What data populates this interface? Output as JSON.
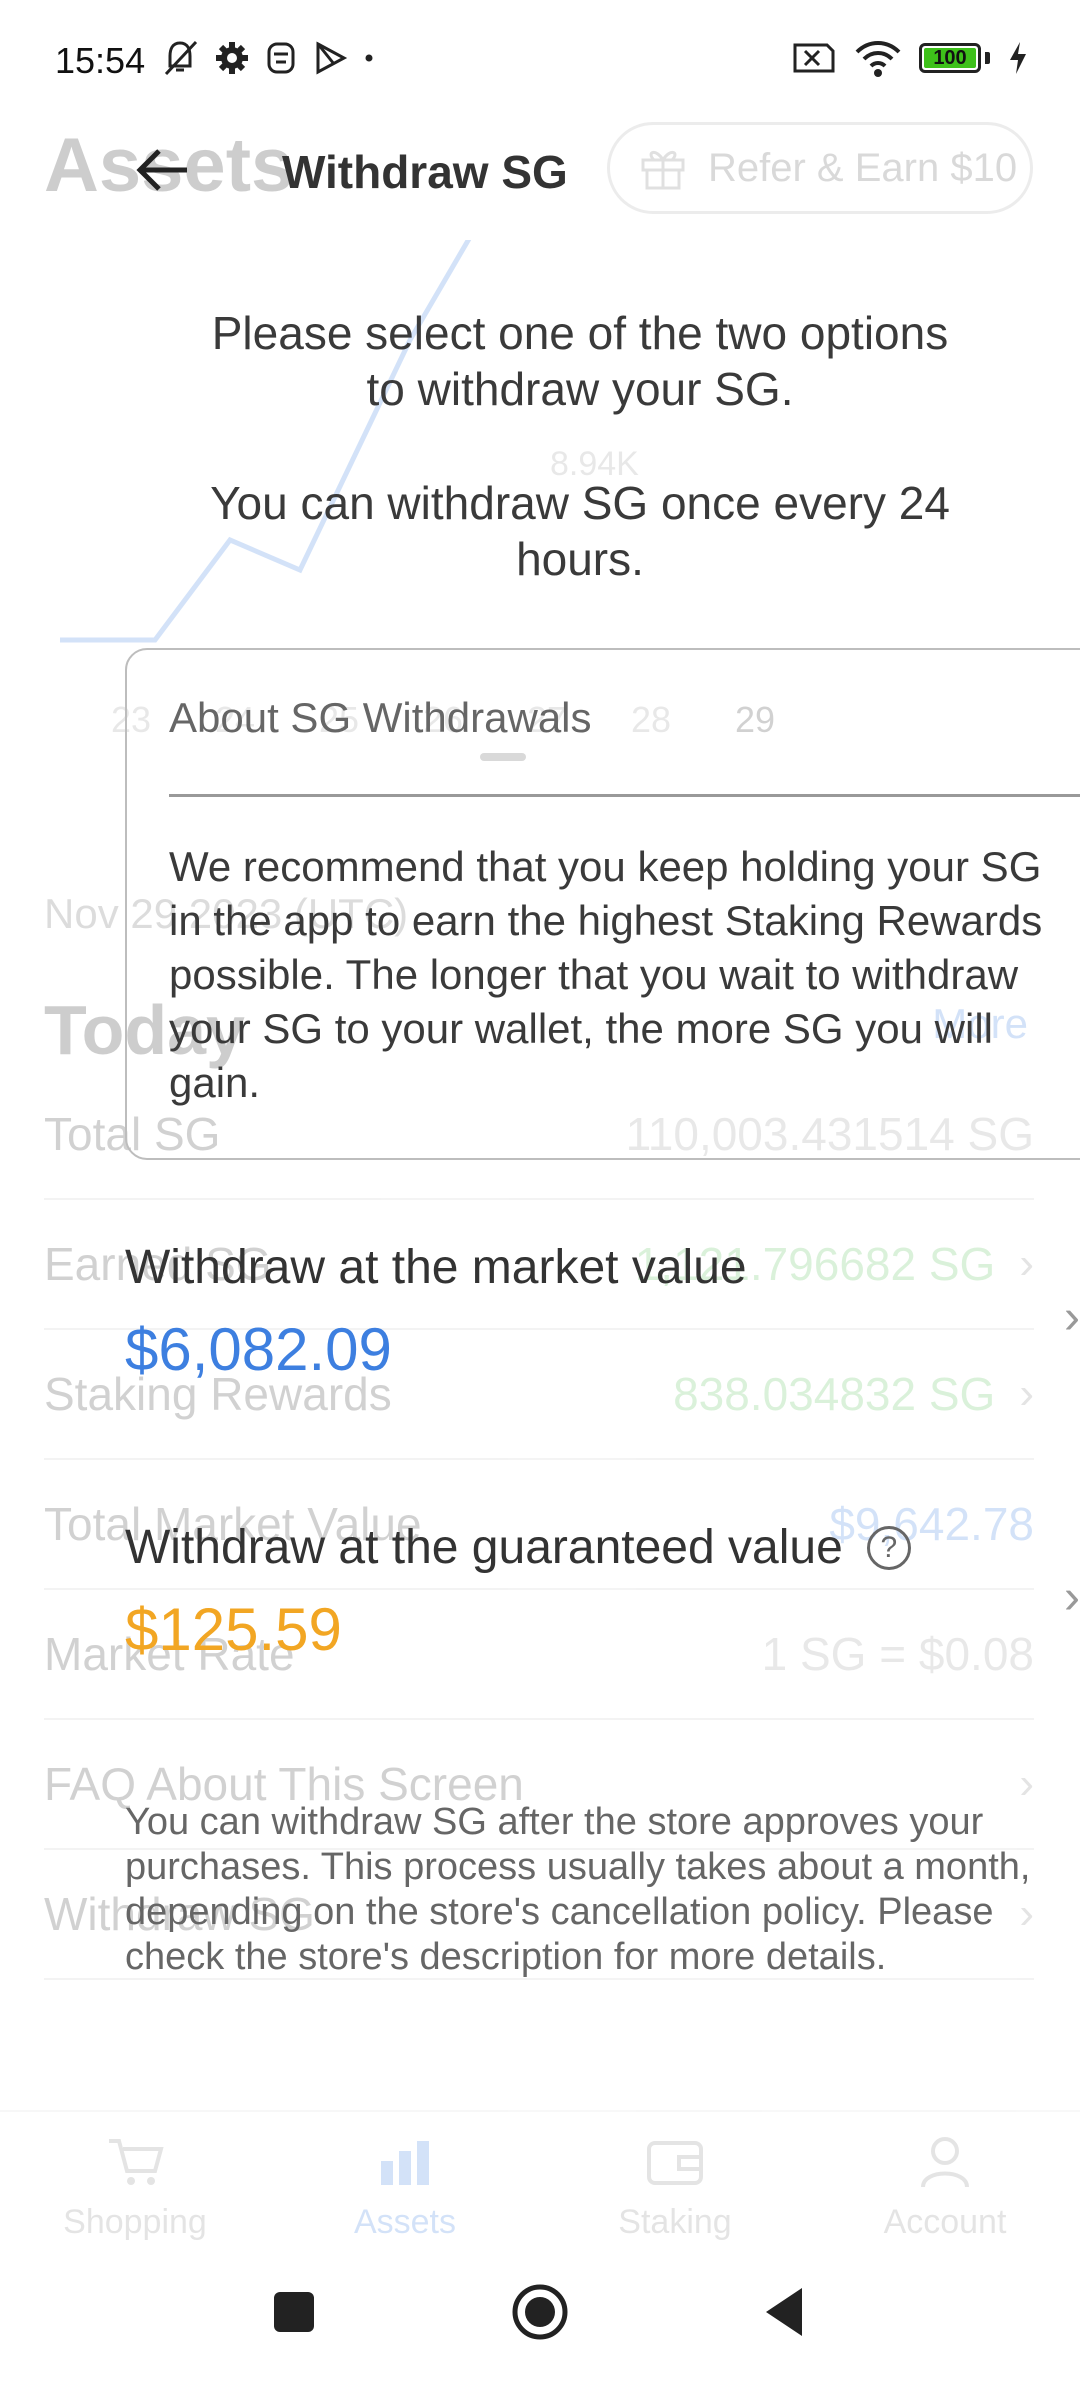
{
  "status_bar": {
    "time": "15:54",
    "battery": "100"
  },
  "background": {
    "title": "Assets",
    "refer_label": "Refer & Earn $10",
    "chart": {
      "days": [
        "23",
        "24",
        "25",
        "26",
        "27",
        "28",
        "29"
      ],
      "selected_day": "29",
      "y_label": "8.94K"
    },
    "date_label": "Nov 29 2023 (UTC)",
    "today_label": "Today",
    "more_label": "More",
    "rows": [
      {
        "label": "Total SG",
        "value": "110,003.431514 SG",
        "tone": "muted",
        "chevron": false
      },
      {
        "label": "Earned SG",
        "value": "1,121.796682 SG",
        "tone": "green",
        "chevron": true
      },
      {
        "label": "Staking Rewards",
        "value": "838.034832 SG",
        "tone": "green",
        "chevron": true
      },
      {
        "label": "Total Market Value",
        "value": "$9,642.78",
        "tone": "blue",
        "chevron": false
      },
      {
        "label": "Market Rate",
        "value": "1 SG = $0.08",
        "tone": "muted",
        "chevron": false
      },
      {
        "label": "FAQ About This Screen",
        "value": "",
        "tone": "muted",
        "chevron": true
      },
      {
        "label": "Withdraw SG",
        "value": "",
        "tone": "muted",
        "chevron": true
      }
    ],
    "nav": [
      {
        "label": "Shopping",
        "icon": "cart-icon"
      },
      {
        "label": "Assets",
        "icon": "bar-chart-icon"
      },
      {
        "label": "Staking",
        "icon": "wallet-icon"
      },
      {
        "label": "Account",
        "icon": "person-icon"
      }
    ]
  },
  "header": {
    "title": "Withdraw SG"
  },
  "intro": {
    "line1": "Please select one of the two options",
    "line2": "to withdraw your SG.",
    "line3": "You can withdraw SG once every 24",
    "line4": "hours."
  },
  "about": {
    "title": "About SG Withdrawals",
    "body": "We recommend that you keep holding your SG in the app to earn the highest Staking Rewards possible. The longer that you wait to withdraw your SG to your wallet, the more SG you will gain."
  },
  "options": {
    "market": {
      "label": "Withdraw at the market value",
      "value": "$6,082.09",
      "color": "#3d7fe0"
    },
    "guaranteed": {
      "label": "Withdraw at the guaranteed value",
      "value": "$125.59",
      "color": "#f2a623",
      "note": "You can withdraw SG after the store approves your purchases. This process usually takes about a month, depending on the store's cancellation policy. Please check the store's description for more details."
    }
  }
}
